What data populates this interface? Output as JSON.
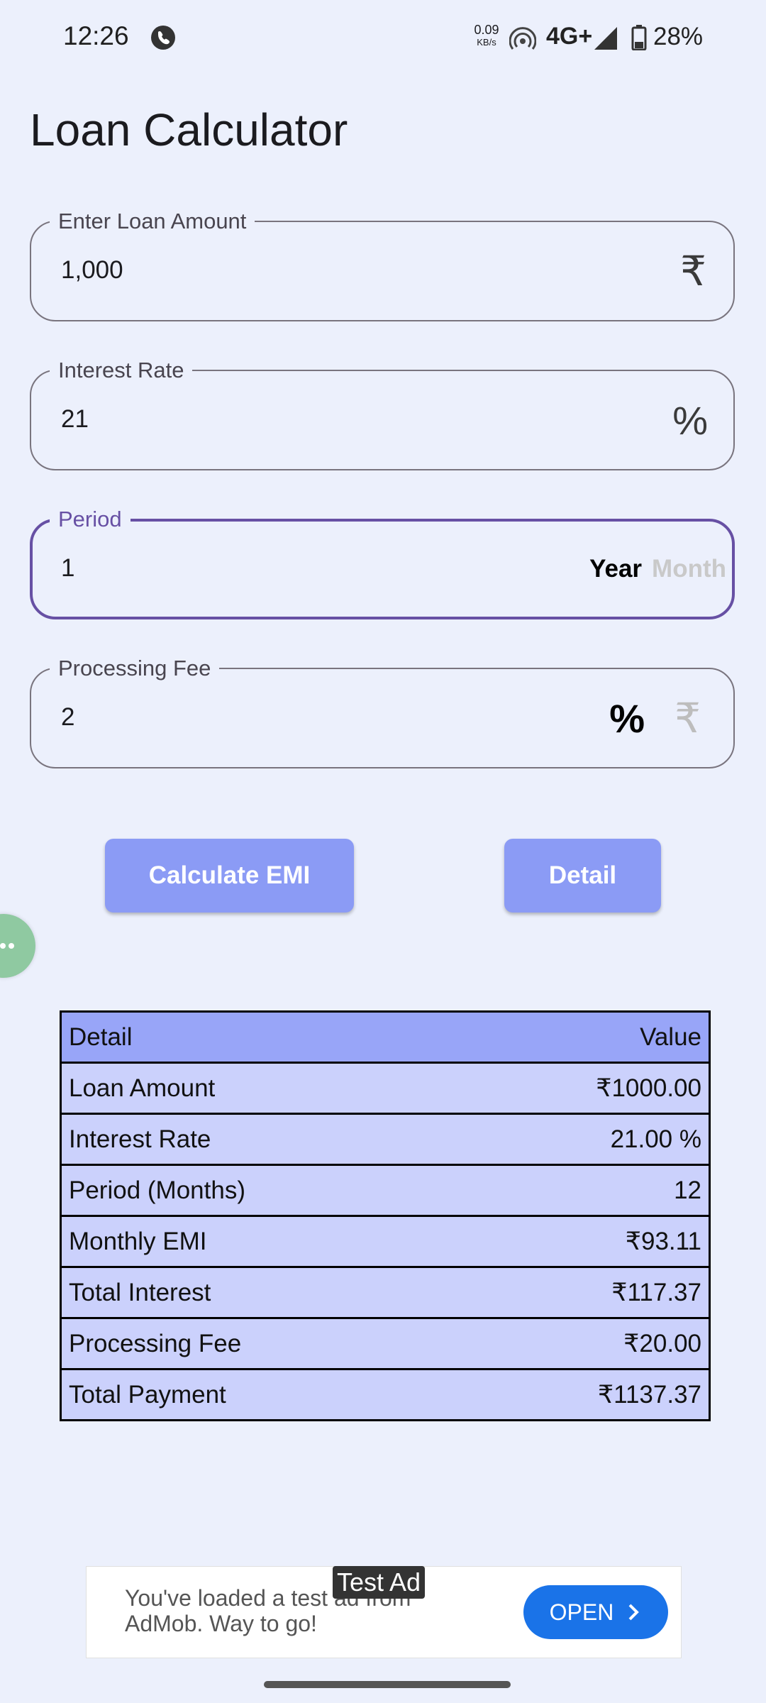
{
  "status_bar": {
    "time": "12:26",
    "net_speed_value": "0.09",
    "net_speed_unit": "KB/s",
    "network_type": "4G+",
    "battery": "28%"
  },
  "app": {
    "title": "Loan Calculator"
  },
  "fields": {
    "loan_amount": {
      "label": "Enter Loan Amount",
      "value": "1,000",
      "suffix": "₹"
    },
    "interest_rate": {
      "label": "Interest Rate",
      "value": "21",
      "suffix": "%"
    },
    "period": {
      "label": "Period",
      "value": "1",
      "unit_selected": "Year",
      "unit_other": "Month"
    },
    "processing_fee": {
      "label": "Processing Fee",
      "value": "2",
      "mode_selected": "%",
      "mode_other": "₹"
    }
  },
  "buttons": {
    "calculate": "Calculate EMI",
    "detail": "Detail"
  },
  "table": {
    "headers": {
      "detail": "Detail",
      "value": "Value"
    },
    "rows": [
      {
        "label": "Loan Amount",
        "value": "₹1000.00"
      },
      {
        "label": "Interest Rate",
        "value": "21.00 %"
      },
      {
        "label": "Period (Months)",
        "value": "12"
      },
      {
        "label": "Monthly EMI",
        "value": "₹93.11"
      },
      {
        "label": "Total Interest",
        "value": "₹117.37"
      },
      {
        "label": "Processing Fee",
        "value": "₹20.00"
      },
      {
        "label": "Total Payment",
        "value": "₹1137.37"
      }
    ]
  },
  "ad": {
    "badge": "Test Ad",
    "text": "You've loaded a test ad from AdMob. Way to go!",
    "cta": "OPEN"
  },
  "colors": {
    "background": "#ECF0FC",
    "button": "#8B9BF5",
    "table_header": "#98A5F8",
    "table_row": "#CBD1FC",
    "focus": "#6750A4"
  }
}
